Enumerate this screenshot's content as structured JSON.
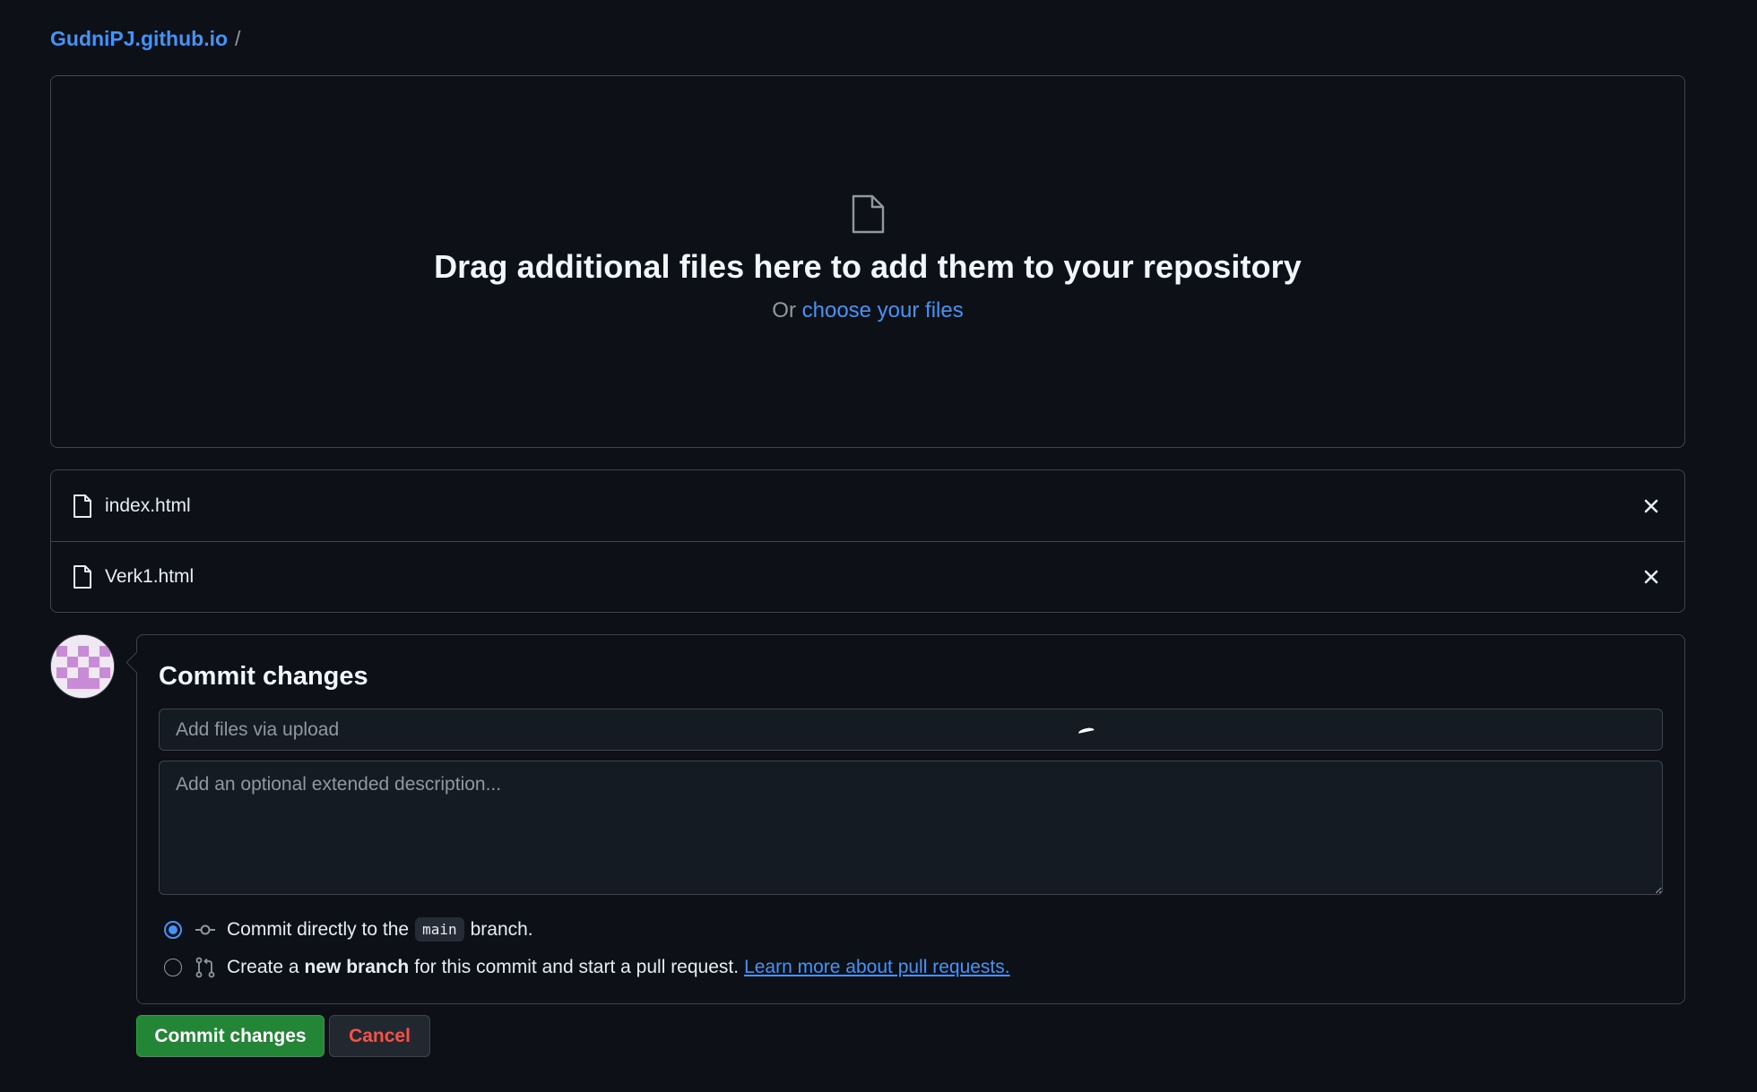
{
  "breadcrumb": {
    "repo": "GudniPJ.github.io",
    "separator": "/"
  },
  "dropzone": {
    "heading": "Drag additional files here to add them to your repository",
    "or_text": "Or",
    "choose_link": "choose your files"
  },
  "files": [
    {
      "name": "index.html"
    },
    {
      "name": "Verk1.html"
    }
  ],
  "commit": {
    "heading": "Commit changes",
    "summary_placeholder": "Add files via upload",
    "description_placeholder": "Add an optional extended description...",
    "option_direct": {
      "prefix": "Commit directly to the",
      "branch": "main",
      "suffix": "branch."
    },
    "option_new_branch": {
      "prefix": "Create a",
      "bold": "new branch",
      "suffix": "for this commit and start a pull request.",
      "link": "Learn more about pull requests."
    }
  },
  "buttons": {
    "commit": "Commit changes",
    "cancel": "Cancel"
  },
  "icons": {
    "file": "file-icon",
    "remove": "x-icon",
    "commit": "git-commit-icon",
    "pull_request": "git-pull-request-icon"
  },
  "colors": {
    "background": "#0d1117",
    "accent_link": "#4493f8",
    "commit_button": "#238636",
    "cancel_text": "#f85149",
    "border": "#3d444d"
  }
}
